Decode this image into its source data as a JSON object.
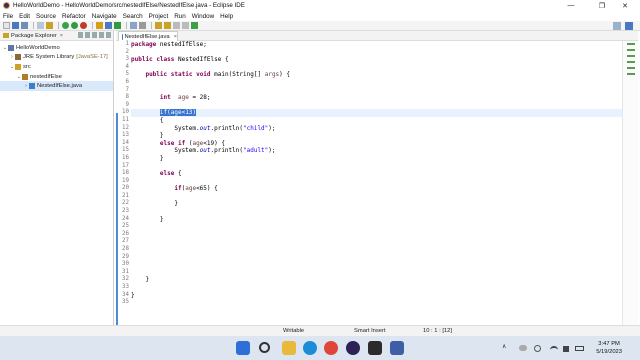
{
  "window": {
    "title": "HelloWorldDemo - HelloWorldDemo/src/nestedIfElse/NestedIfElse.java - Eclipse IDE",
    "minimize": "—",
    "maximize": "❐",
    "close": "✕"
  },
  "menu": [
    "File",
    "Edit",
    "Source",
    "Refactor",
    "Navigate",
    "Search",
    "Project",
    "Run",
    "Window",
    "Help"
  ],
  "explorer": {
    "title": "Package Explorer",
    "close": "×",
    "tree": [
      {
        "label": "HelloWorldDemo",
        "arrow": "⌄",
        "indent": 0
      },
      {
        "label": "JRE System Library",
        "suffix": "[JavaSE-17]",
        "arrow": "›",
        "indent": 1
      },
      {
        "label": "src",
        "arrow": "⌄",
        "indent": 1
      },
      {
        "label": "nestedIfElse",
        "arrow": "⌄",
        "indent": 2
      },
      {
        "label": "NestedIfElse.java",
        "arrow": "›",
        "indent": 3,
        "selected": true
      }
    ]
  },
  "editor": {
    "tab_label": "NestedIfElse.java",
    "tab_close": "×",
    "line_numbers": [
      "1",
      "2",
      "3",
      "4",
      "5",
      "6",
      "7",
      "8",
      "9",
      "10",
      "11",
      "12",
      "13",
      "14",
      "15",
      "16",
      "17",
      "18",
      "19",
      "20",
      "21",
      "22",
      "23",
      "24",
      "25",
      "26",
      "27",
      "28",
      "29",
      "30",
      "31",
      "32",
      "33",
      "34",
      "35"
    ],
    "fold_markers": {
      "2": "⊖",
      "3": "⊖"
    },
    "highlight_line": 10
  },
  "status": {
    "mode": "Writable",
    "insert": "Smart Insert",
    "position": "10 : 1 : [12]"
  },
  "taskbar": {
    "time": "3:47 PM",
    "date": "5/19/2023",
    "tray_chevron": "∧"
  },
  "colors": {
    "keyword": "#7f0055",
    "string": "#2a00ff",
    "field": "#0000c0",
    "selection": "#3873cf",
    "current_line": "#e8f2fe"
  }
}
